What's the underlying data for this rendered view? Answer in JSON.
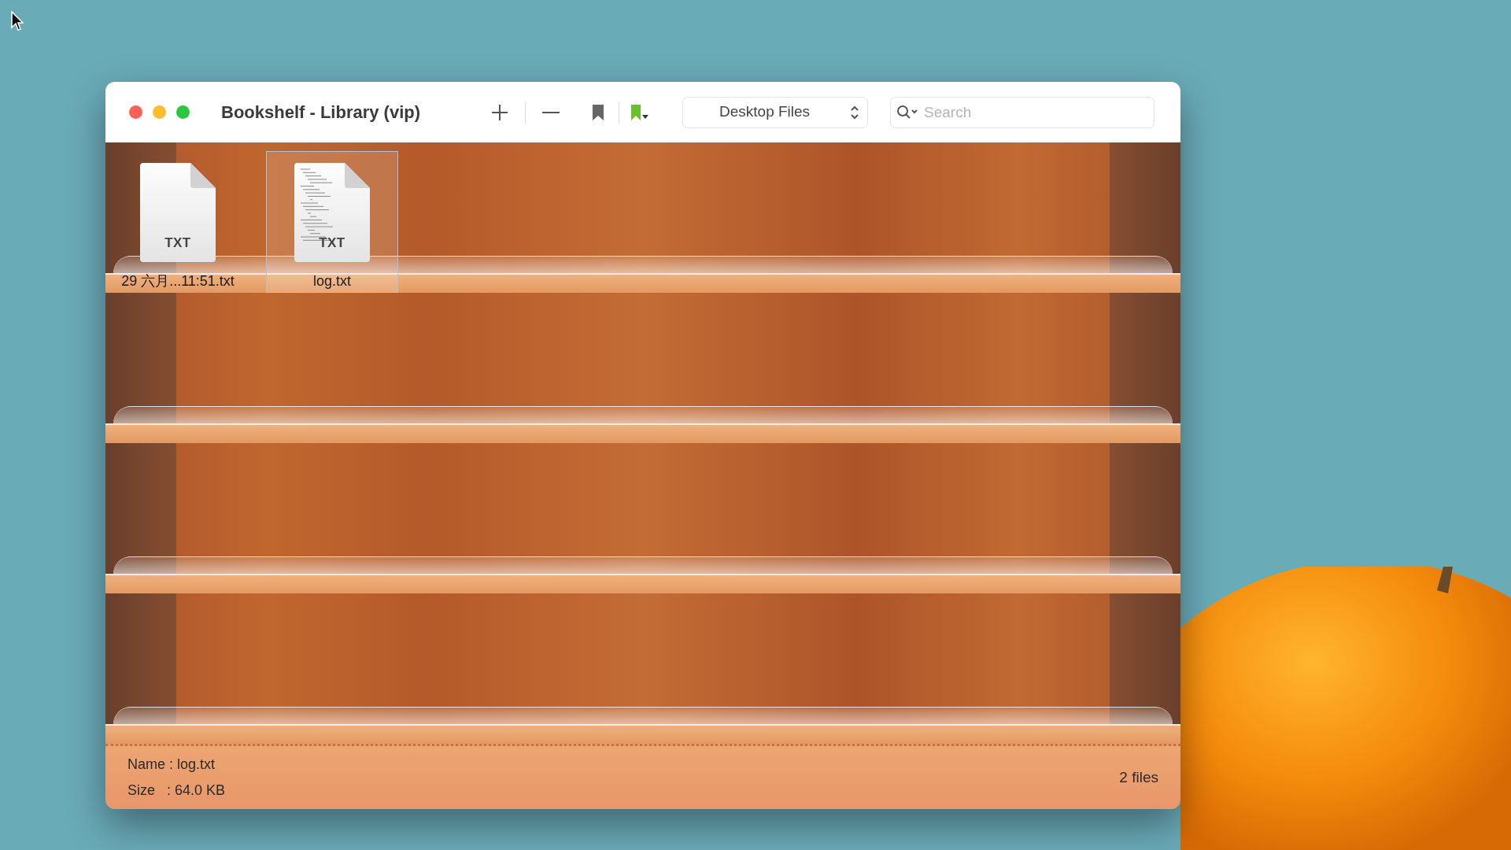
{
  "window": {
    "title": "Bookshelf - Library (vip)"
  },
  "toolbar": {
    "source": "Desktop Files",
    "search": {
      "placeholder": "Search"
    }
  },
  "files": [
    {
      "name": "29 六月...11:51.txt",
      "type": "TXT",
      "selected": false,
      "has_preview": false
    },
    {
      "name": "log.txt",
      "type": "TXT",
      "selected": true,
      "has_preview": true
    }
  ],
  "status_bar": {
    "name_line": "Name : log.txt",
    "size_line": "Size   : 64.0 KB",
    "count": "2 files"
  }
}
